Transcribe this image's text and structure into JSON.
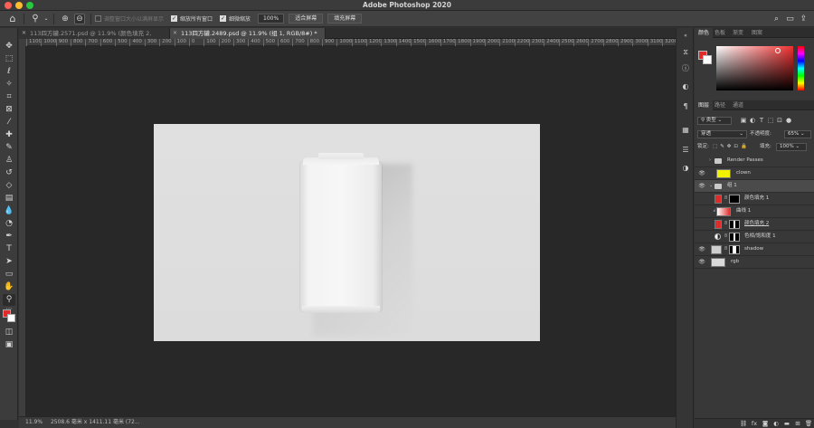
{
  "window": {
    "title": "Adobe Photoshop 2020",
    "traffic_colors": [
      "#fe5f57",
      "#febc2e",
      "#28c840"
    ]
  },
  "options_bar": {
    "home_icon": "home-icon",
    "zoom_icon": "zoom-tool-icon",
    "resize_windows_label": "调整窗口大小以满屏显示",
    "resize_windows_checked": false,
    "zoom_all_windows_label": "缩放所有窗口",
    "zoom_all_windows_checked": true,
    "scrubby_zoom_label": "细微缩放",
    "scrubby_zoom_checked": true,
    "zoom_value": "100%",
    "fit_screen_label": "适合屏幕",
    "fill_screen_label": "填充屏幕"
  },
  "tabs": [
    {
      "label": "113四方罐.2571.psd @ 11.9% (颜色填充 2, RGB/8#)",
      "active": false
    },
    {
      "label": "113四方罐.2489.psd @ 11.9% (组 1, RGB/8#) *",
      "active": true
    }
  ],
  "ruler": {
    "ticks": [
      "1100",
      "1000",
      "900",
      "800",
      "700",
      "600",
      "500",
      "400",
      "300",
      "200",
      "100",
      "0",
      "100",
      "200",
      "300",
      "400",
      "500",
      "600",
      "700",
      "800",
      "900",
      "1000",
      "1100",
      "1200",
      "1300",
      "1400",
      "1500",
      "1600",
      "1700",
      "1800",
      "1900",
      "2000",
      "2100",
      "2200",
      "2300",
      "2400",
      "2500",
      "2600",
      "2700",
      "2800",
      "2900",
      "3000",
      "3100",
      "3200",
      "3300"
    ]
  },
  "toolbar": {
    "foreground_color": "#e02b2b",
    "background_color": "#ffffff"
  },
  "status_bar": {
    "zoom": "11.9%",
    "doc_info": "2508.6 毫米 x 1411.11 毫米 (72..."
  },
  "color_panel": {
    "tabs": [
      "颜色",
      "色板",
      "渐变",
      "图案"
    ],
    "foreground_color": "#e02b2b"
  },
  "layers_panel": {
    "tabs": [
      "图层",
      "路径",
      "通道"
    ],
    "filter_label": "类型",
    "blend_mode": "穿透",
    "opacity_label": "不透明度:",
    "opacity_value": "65%",
    "lock_label": "锁定:",
    "fill_label": "填充:",
    "fill_value": "100%",
    "layers": [
      {
        "name": "Render Passes",
        "kind": "group",
        "visible": false
      },
      {
        "name": "clown",
        "kind": "image",
        "visible": true,
        "thumb_color": "#f2f200"
      },
      {
        "name": "组 1",
        "kind": "group",
        "visible": true,
        "selected": true
      },
      {
        "name": "颜色填充 1",
        "kind": "fill",
        "visible": false,
        "thumb_color": "#e02b2b"
      },
      {
        "name": "曲线 1",
        "kind": "curves",
        "visible": false
      },
      {
        "name": "颜色填充 2",
        "kind": "fill",
        "visible": false,
        "thumb_color": "#e02b2b"
      },
      {
        "name": "色相/饱和度 1",
        "kind": "adjustment",
        "visible": false
      },
      {
        "name": "shadow",
        "kind": "image",
        "visible": true,
        "thumb_color": "#cfcfcf"
      },
      {
        "name": "rgb",
        "kind": "image",
        "visible": true,
        "thumb_color": "#d9d9d9"
      }
    ]
  }
}
